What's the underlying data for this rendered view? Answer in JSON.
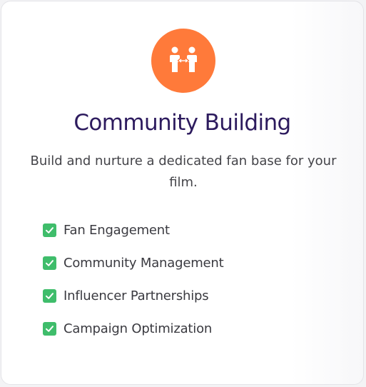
{
  "card": {
    "icon": "people-exchange-icon",
    "title": "Community Building",
    "description": "Build and nurture a dedicated fan base for your film.",
    "features": [
      {
        "label": "Fan Engagement",
        "icon": "check-mark-icon"
      },
      {
        "label": "Community Management",
        "icon": "check-mark-icon"
      },
      {
        "label": "Influencer Partnerships",
        "icon": "check-mark-icon"
      },
      {
        "label": "Campaign Optimization",
        "icon": "check-mark-icon"
      }
    ]
  },
  "colors": {
    "accent": "#ff7a3a",
    "title": "#2d1b5e",
    "check": "#3fbd6b"
  }
}
